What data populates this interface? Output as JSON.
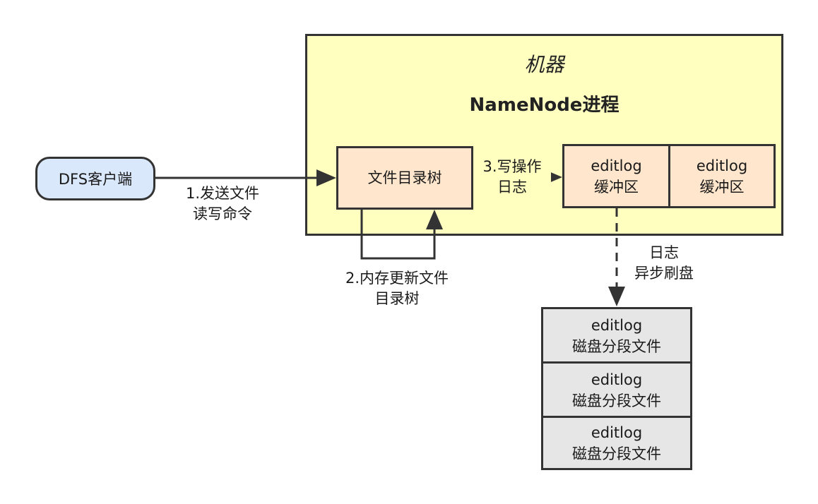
{
  "machine": {
    "title": "机器",
    "process_title": "NameNode进程"
  },
  "client": {
    "label": "DFS客户端"
  },
  "tree": {
    "label": "文件目录树"
  },
  "buffers": [
    {
      "line1": "editlog",
      "line2": "缓冲区"
    },
    {
      "line1": "editlog",
      "line2": "缓冲区"
    }
  ],
  "segments": [
    {
      "line1": "editlog",
      "line2": "磁盘分段文件"
    },
    {
      "line1": "editlog",
      "line2": "磁盘分段文件"
    },
    {
      "line1": "editlog",
      "line2": "磁盘分段文件"
    }
  ],
  "edges": {
    "send": {
      "line1": "1.发送文件",
      "line2": "读写命令"
    },
    "update": {
      "line1": "2.内存更新文件",
      "line2": "目录树"
    },
    "write_log": {
      "line1": "3.写操作",
      "line2": "日志"
    },
    "flush": {
      "line1": "日志",
      "line2": "异步刷盘"
    }
  },
  "colors": {
    "machine_fill": "#ffffc0",
    "client_fill": "#dae8fc",
    "node_fill": "#ffe6cc",
    "segment_fill": "#e6e6e6",
    "stroke": "#333333"
  }
}
